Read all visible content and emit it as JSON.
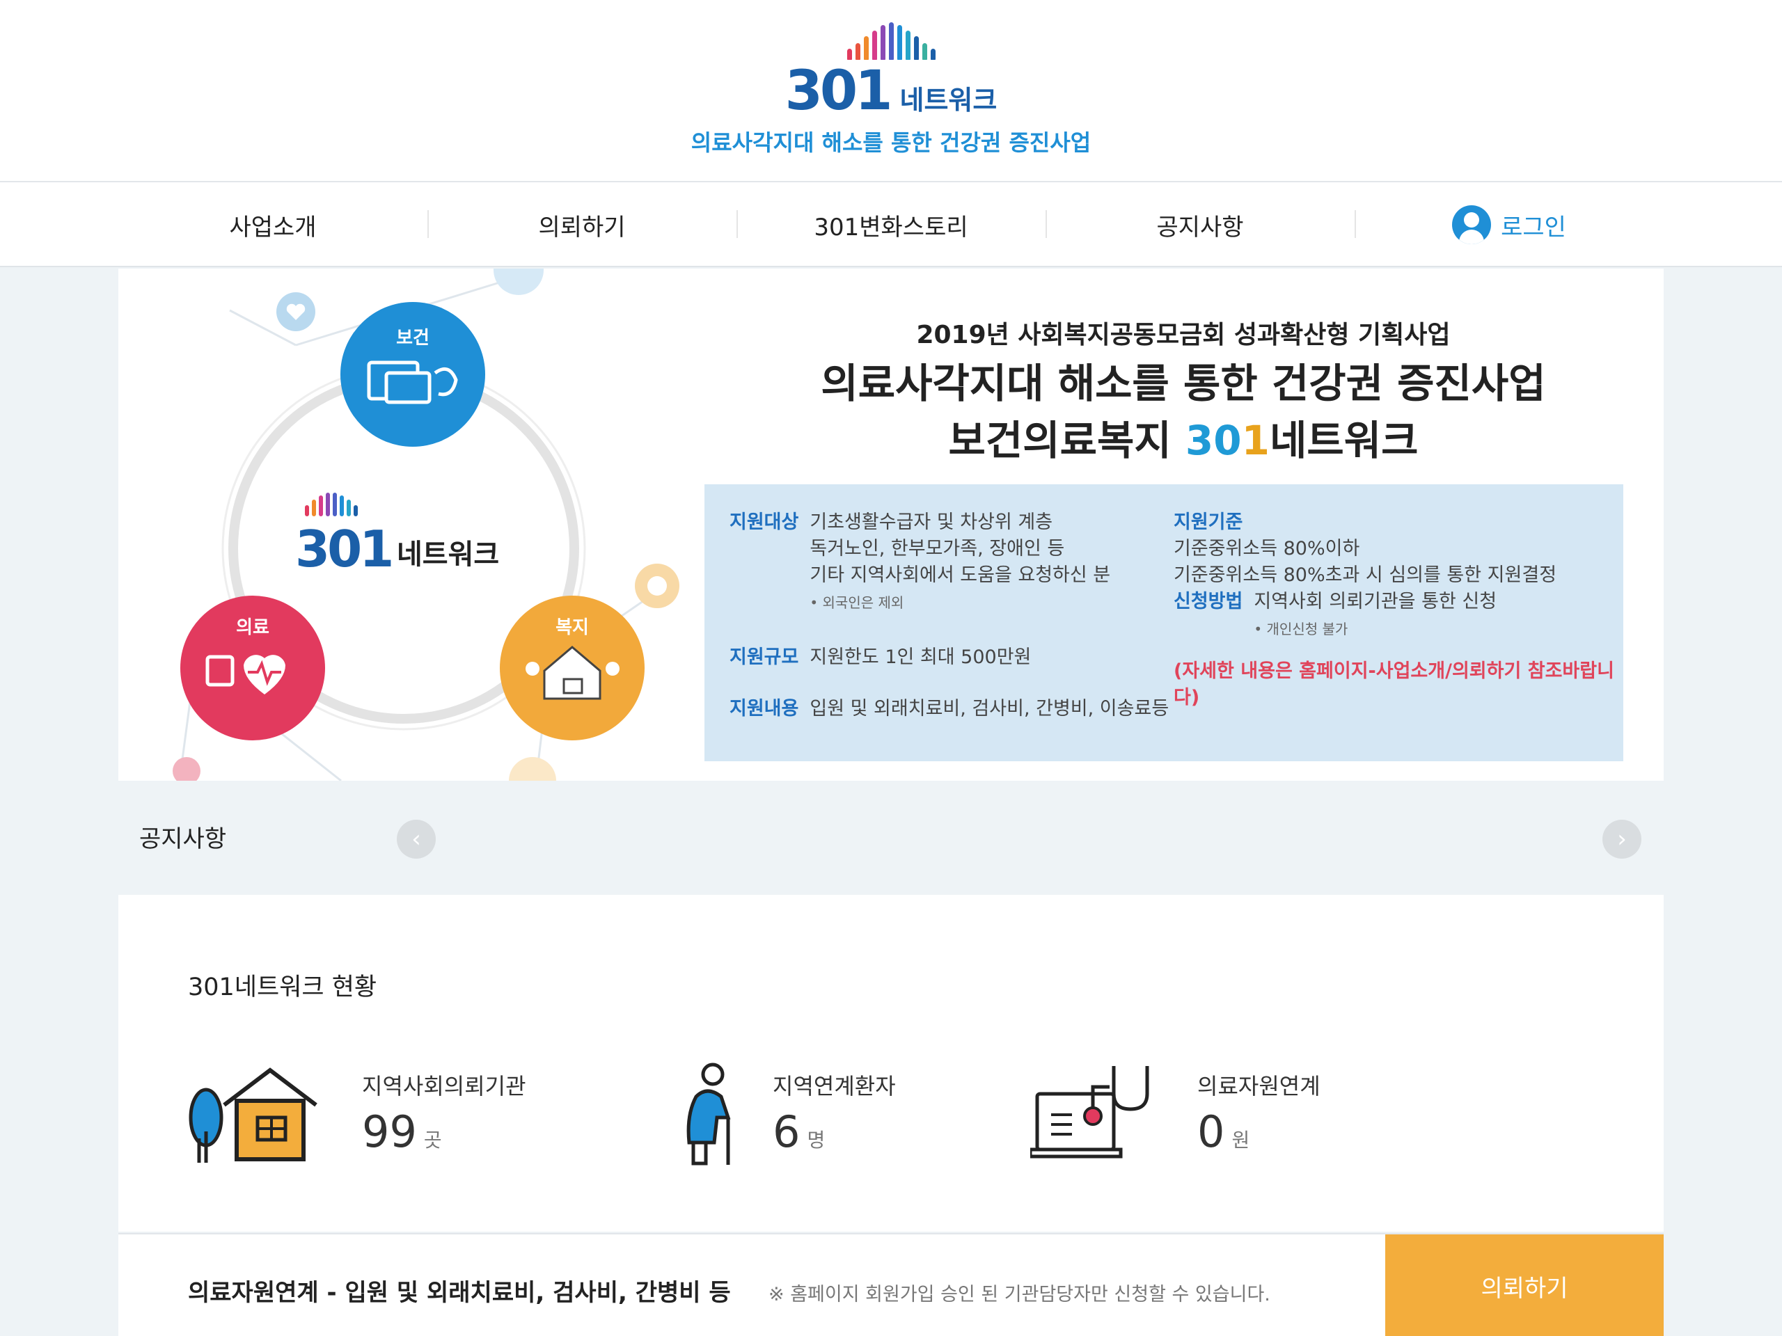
{
  "header": {
    "logo_number": "301",
    "logo_word": "네트워크",
    "tagline": "의료사각지대 해소를 통한 건강권 증진사업"
  },
  "nav": {
    "items": [
      "사업소개",
      "의뢰하기",
      "301변화스토리",
      "공지사항"
    ],
    "login": "로그인"
  },
  "banner": {
    "circle_labels": {
      "health": "보건",
      "medical": "의료",
      "welfare": "복지"
    },
    "center_logo": {
      "number": "301",
      "word": "네트워크"
    },
    "title_line1": "2019년 사회복지공동모금회 성과확산형 기획사업",
    "title_line2": "의료사각지대 해소를 통한 건강권 증진사업",
    "title_line3_prefix": "보건의료복지 ",
    "title_line3_num_a": "30",
    "title_line3_num_b": "1",
    "title_line3_suffix": "네트워크",
    "info": {
      "target_key": "지원대상",
      "target_lines": [
        "기초생활수급자 및 차상위 계층",
        "독거노인, 한부모가족, 장애인 등",
        "기타 지역사회에서 도움을 요청하신 분"
      ],
      "target_note": "• 외국인은 제외",
      "scale_key": "지원규모",
      "scale_val": "지원한도 1인 최대 500만원",
      "content_key": "지원내용",
      "content_val": "입원 및 외래치료비, 검사비, 간병비, 이송료등",
      "criteria_key": "지원기준",
      "criteria_lines": [
        "기준중위소득 80%이하",
        "기준중위소득 80%초과 시 심의를 통한 지원결정"
      ],
      "method_key": "신청방법",
      "method_val": "지역사회 의뢰기관을 통한 신청",
      "method_note": "• 개인신청 불가",
      "notice_red": "(자세한 내용은 홈페이지-사업소개/의뢰하기 참조바랍니다)"
    }
  },
  "notice": {
    "title": "공지사항",
    "prev_icon": "‹",
    "next_icon": "›"
  },
  "status": {
    "title": "301네트워크 현황",
    "stats": [
      {
        "label": "지역사회의뢰기관",
        "value": "99",
        "unit": "곳",
        "icon": "house-icon"
      },
      {
        "label": "지역연계환자",
        "value": "6",
        "unit": "명",
        "icon": "elderly-person-icon"
      },
      {
        "label": "의료자원연계",
        "value": "0",
        "unit": "원",
        "icon": "medical-device-icon"
      }
    ]
  },
  "bottom": {
    "text": "의료자원연계 - 입원 및 외래치료비, 검사비, 간병비 등",
    "note": "※ 홈페이지 회원가입 승인 된 기관담당자만 신청할 수 있습니다.",
    "button": "의뢰하기"
  },
  "colors": {
    "primary_blue": "#1f8fd6",
    "logo_blue": "#1b5fa8",
    "accent_orange": "#f3ad3c",
    "medical_red": "#e23a5e",
    "welfare_orange": "#f2a93b",
    "info_bg": "#d5e7f4"
  }
}
